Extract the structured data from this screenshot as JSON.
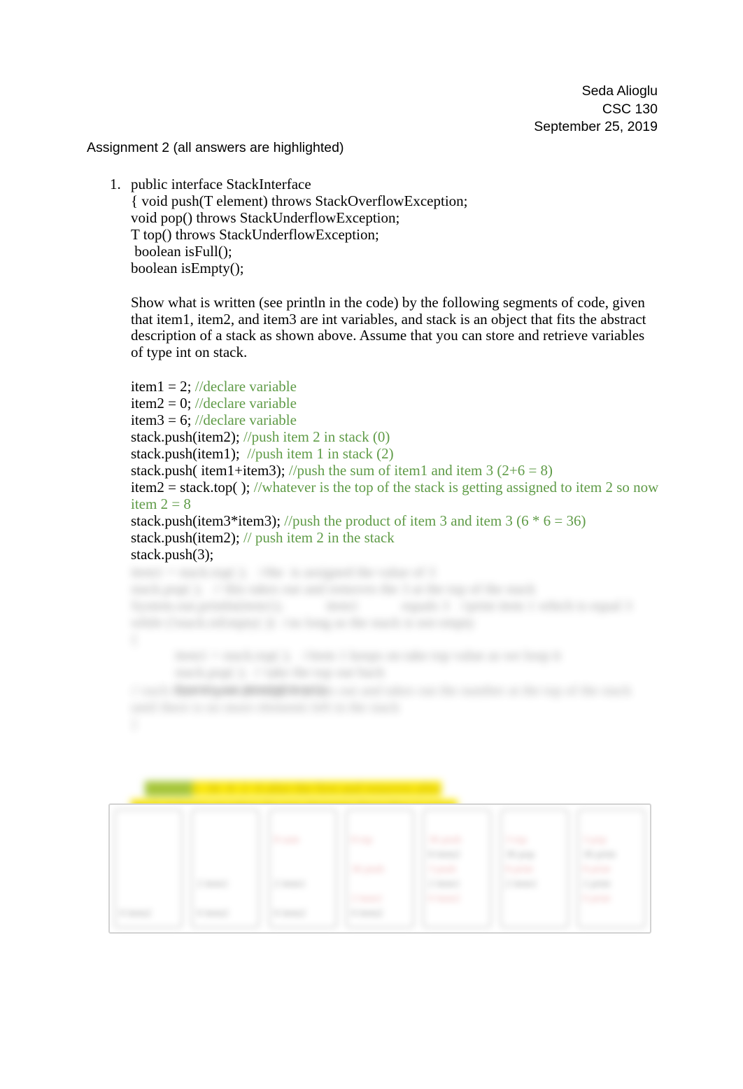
{
  "header": {
    "author": "Seda Alioglu",
    "course": "CSC 130",
    "date": "September 25, 2019"
  },
  "assignment": {
    "title": "Assignment 2 (all answers are highlighted)"
  },
  "question_1": {
    "marker": "1.",
    "interface_code": "public interface StackInterface\n{ void push(T element) throws StackOverflowException;\nvoid pop() throws StackUnderflowException;\nT top() throws StackUnderflowException;\n boolean isFull();\nboolean isEmpty();",
    "prompt": "Show what is written (see println in the code) by the following segments of code, given that item1, item2, and item3 are int variables, and stack is an object that fits the abstract description of a stack as shown above. Assume that you can store and retrieve variables of type int on stack."
  },
  "code_segment": {
    "lines": [
      {
        "code": "item1 = 2; ",
        "comment": "//declare variable"
      },
      {
        "code": "item2 = 0; ",
        "comment": "//declare variable"
      },
      {
        "code": "item3 = 6; ",
        "comment": "//declare variable"
      },
      {
        "code": "stack.push(item2); ",
        "comment": "//push item 2 in stack (0)"
      },
      {
        "code": "stack.push(item1);  ",
        "comment": "//push item 1 in stack (2)"
      },
      {
        "code": "stack.push( item1+item3); ",
        "comment": "//push the sum of item1 and item 3 (2+6 = 8)"
      },
      {
        "code": "item2 = stack.top( ); ",
        "comment": "//whatever is the top of the stack is getting assigned to item 2 so now item 2 = 8"
      },
      {
        "code": "stack.push(item3*item3); ",
        "comment": "//push the product of item 3 and item 3 (6 * 6 = 36)"
      },
      {
        "code": "stack.push(item2); ",
        "comment": "// push item 2 in the stack"
      },
      {
        "code": "stack.push(3);",
        "comment": ""
      }
    ]
  },
  "redacted": {
    "note": "illegible blurred content",
    "block_1": "item1 = stack.top( );   //the  is assigned the value of 3\nstack.pop( );   // this takes out and removes the 3 at the top of the stack\nSystem.out.println(item1);            item1            equals 3   //print item 1 which is equal 3\nwhile (!stack.isEmpty( ))  //as long as the stack is not empty\n{",
    "block_2": "item1 = stack.top( );   //item 1 keeps on take top value as we loop it\nstack.pop( );  // take the top out back\nSystem.out.println(item1);",
    "block_3": "// each time it goes through it prints out and takes out the number at the top of the stack until there is no more elements left in the stack\n}"
  },
  "highlight_answer": {
    "line_1_green": "Answer:",
    "line_1": "3  36  8  2  0 after the first and removes after",
    "line_2": "the 3  it keeps on takes the top elements thereafter it prints"
  },
  "stack_diagram": {
    "columns": [
      {
        "cells": [
          "",
          "",
          "",
          "",
          "",
          "0 item2"
        ]
      },
      {
        "cells": [
          "",
          "",
          "",
          "2 item1",
          "",
          "0 item2"
        ]
      },
      {
        "cells": [
          "8 sum",
          "",
          "",
          "2 item1",
          "",
          "0 item2"
        ]
      },
      {
        "cells": [
          "8 top",
          "",
          "36 push",
          "",
          "2 item1",
          "0 item2"
        ]
      },
      {
        "cells": [
          "36 push",
          "8 item2",
          "3 push",
          "2 item1",
          "0 item2",
          ""
        ]
      },
      {
        "cells": [
          "3 top",
          "36 pop",
          "8 print",
          "2 item1",
          "",
          ""
        ]
      },
      {
        "cells": [
          "3 pop",
          "36 print",
          "8 print",
          "2 print",
          "0 print",
          ""
        ]
      }
    ]
  },
  "colors": {
    "comment_green": "#5f9b47",
    "highlight_yellow": "#fcea10",
    "highlight_green": "#a9c93c",
    "diagram_border": "#cccccc",
    "stack_text_red": "#e8a3a3",
    "body_text": "#000000"
  }
}
